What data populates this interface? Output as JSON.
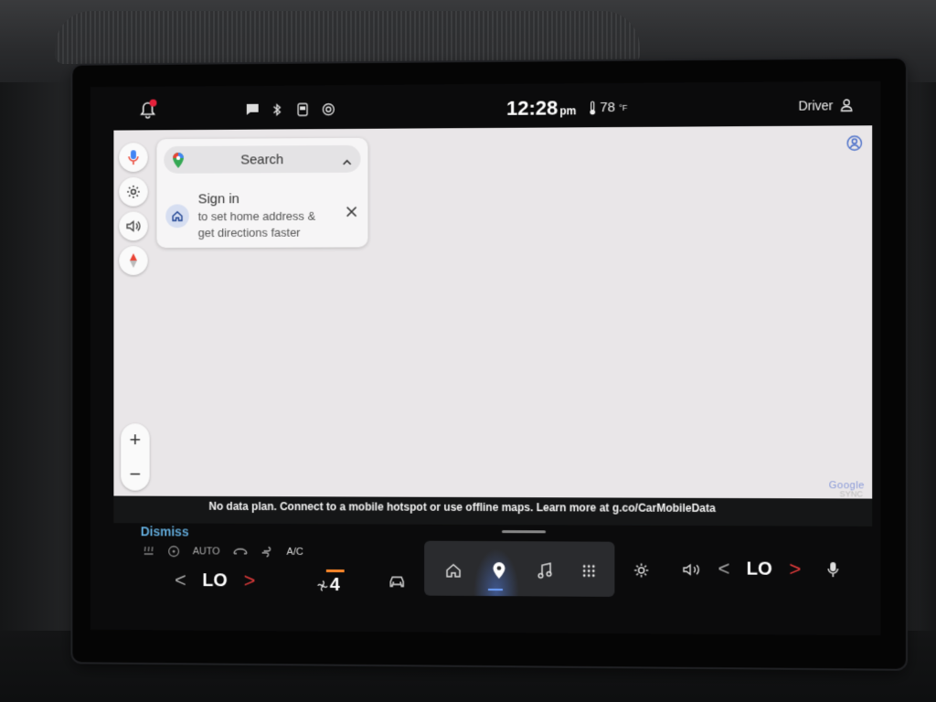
{
  "status_bar": {
    "time": "12:28",
    "ampm": "pm",
    "temperature": "78",
    "temp_unit": "°F",
    "profile": "Driver",
    "icons": [
      "notification-bell-icon",
      "message-icon",
      "bluetooth-icon",
      "phone-icon",
      "android-auto-icon"
    ]
  },
  "map": {
    "search_label": "Search",
    "signin_title": "Sign in",
    "signin_subtitle": "to set home address & get directions faster",
    "google_logo": "Google",
    "zoom_in": "+",
    "zoom_out": "−"
  },
  "notice": {
    "dismiss": "Dismiss",
    "message": "No data plan. Connect to a mobile hotspot or use offline maps. Learn more at g.co/CarMobileData",
    "sync": "SYNC"
  },
  "climate": {
    "auto": "AUTO",
    "ac": "A/C",
    "left_temp": "LO",
    "right_temp": "LO",
    "fan_speed": "4",
    "left_arrow": "<",
    "right_arrow": ">"
  },
  "colors": {
    "accent_blue": "#61a9d8",
    "temp_arrow_red": "#e23b3b",
    "fan_orange": "#ff8a2b",
    "map_bg": "#e9e6e8"
  }
}
